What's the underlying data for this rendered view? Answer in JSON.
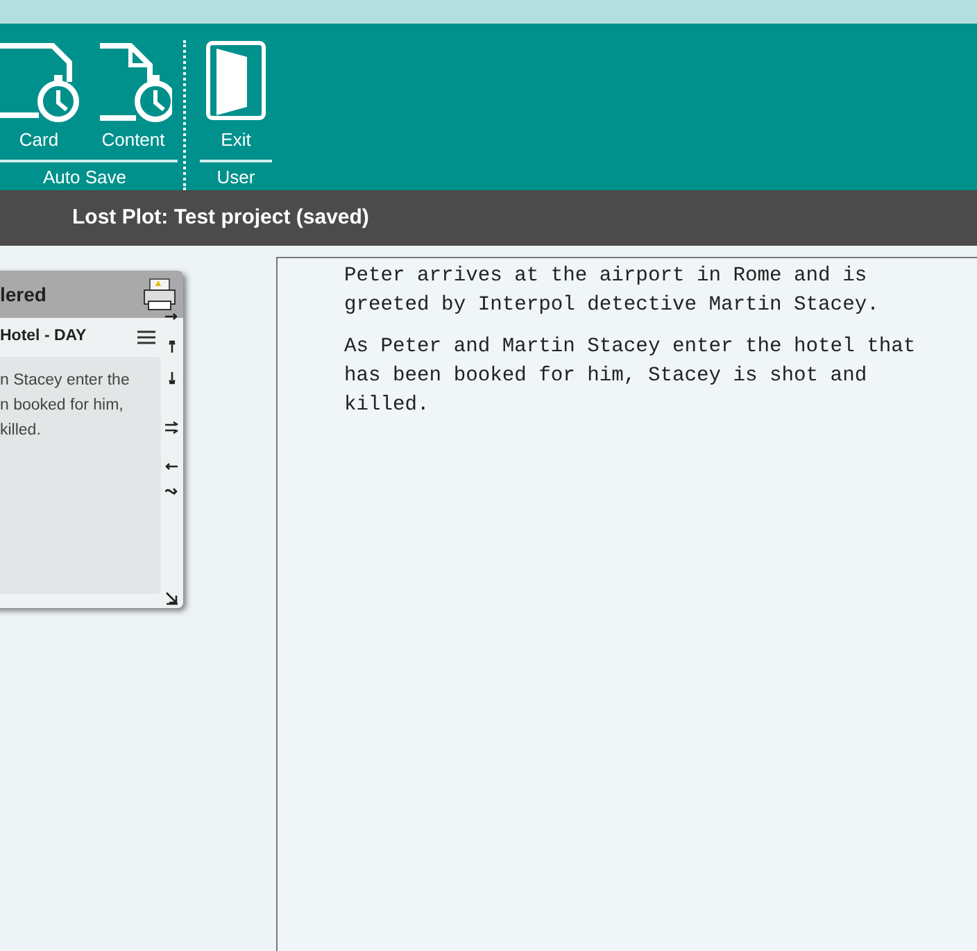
{
  "ribbon": {
    "groups": [
      {
        "label": "Auto Save",
        "buttons": [
          {
            "label": "Card",
            "kind": "card-clock"
          },
          {
            "label": "Content",
            "kind": "page-clock"
          }
        ]
      },
      {
        "label": "User",
        "buttons": [
          {
            "label": "Exit",
            "kind": "door"
          }
        ]
      }
    ]
  },
  "project_bar": {
    "title": "Lost Plot: Test project (saved)"
  },
  "card": {
    "title": "lered",
    "heading": "Hotel - DAY",
    "text": "n Stacey enter the\nn booked for him,\nkilled."
  },
  "editor": {
    "paragraphs": [
      "Peter arrives at the airport in Rome and is greeted by Interpol detective Martin Stacey.",
      "As Peter and Martin Stacey enter the hotel that has been booked for him, Stacey is shot and killed."
    ]
  }
}
